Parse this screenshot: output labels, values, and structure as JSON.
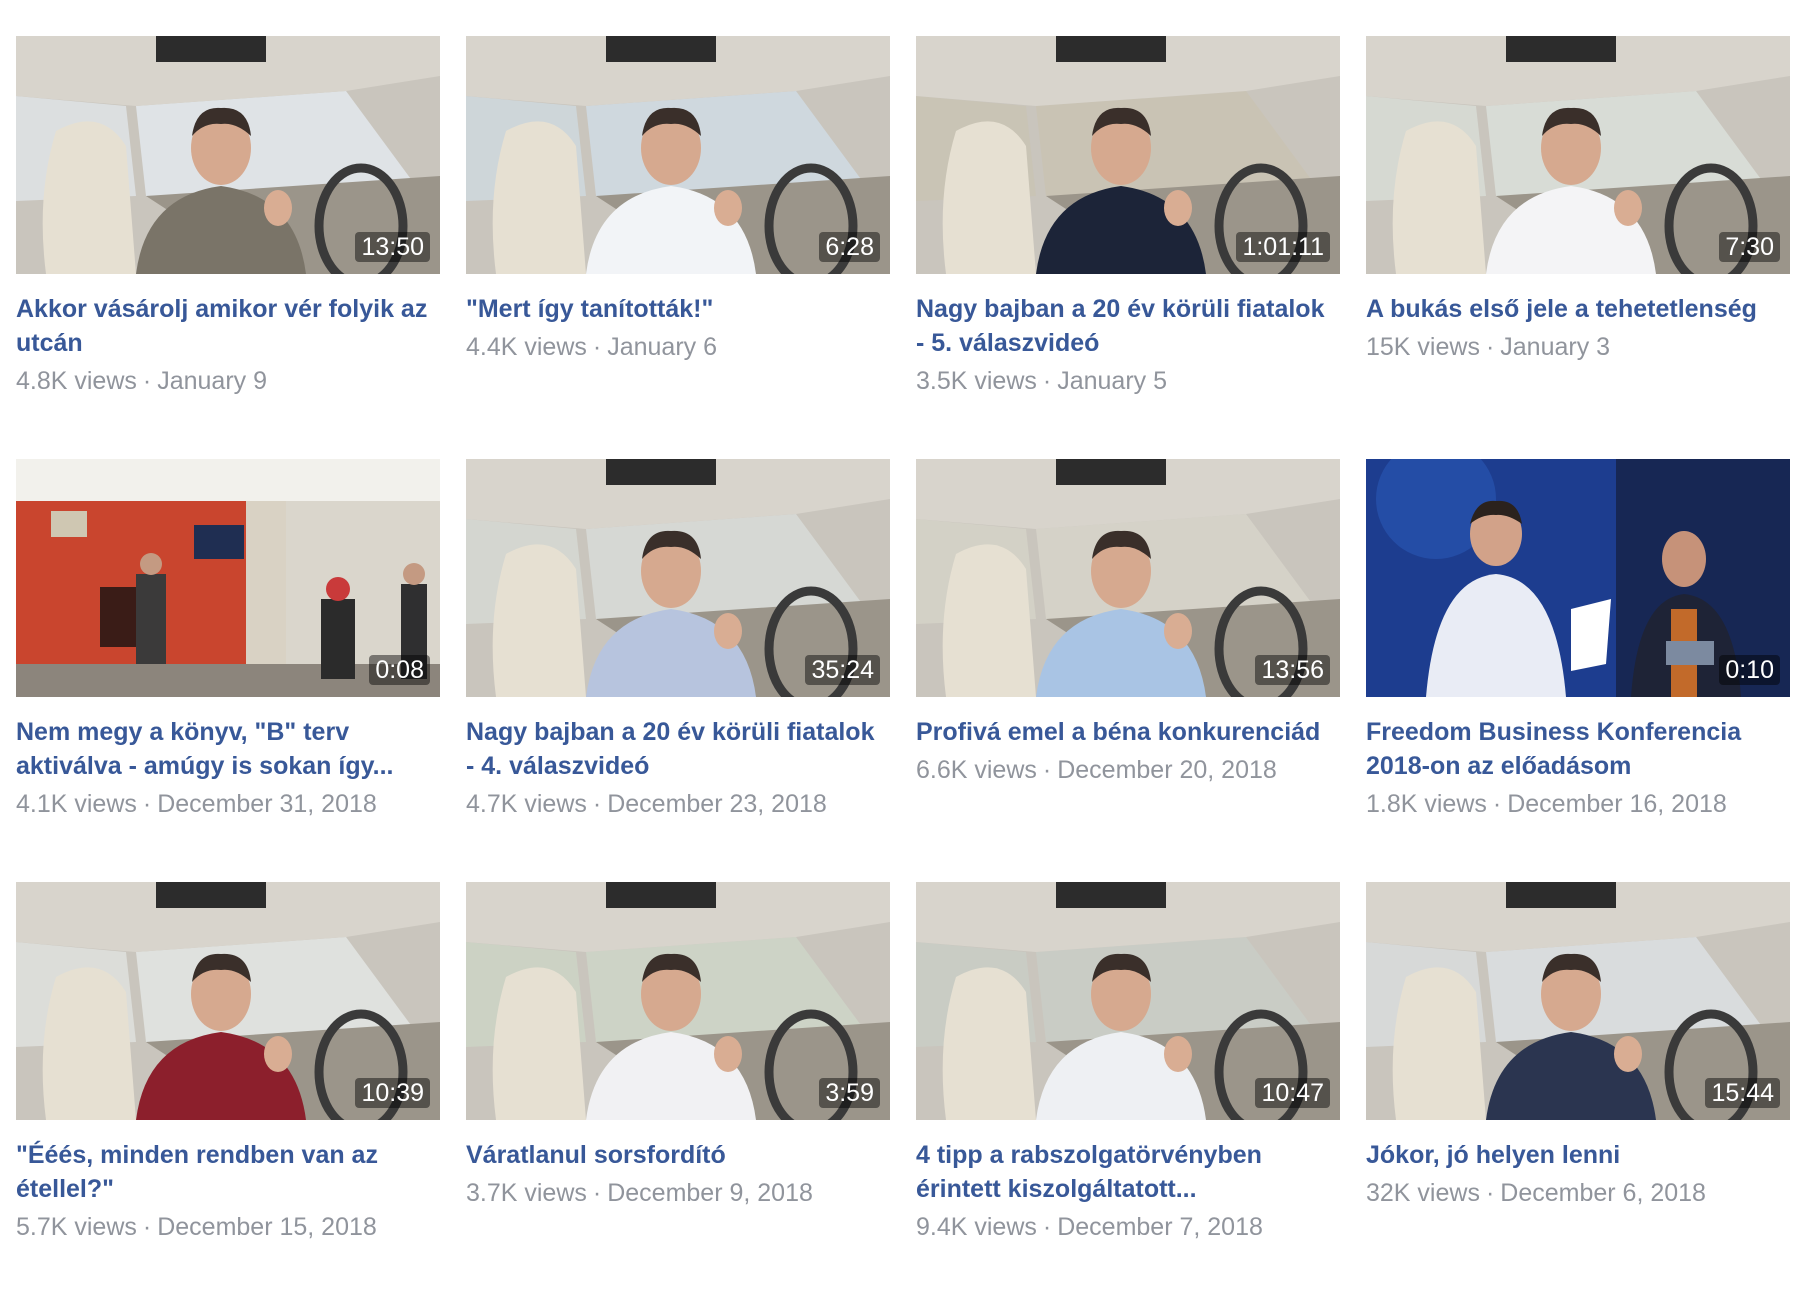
{
  "videos": [
    {
      "title": "Akkor vásárolj amikor vér folyik az utcán",
      "views": "4.8K views",
      "date": "January 9",
      "duration": "13:50",
      "scene": "car",
      "shirt": "#7a7468",
      "sky": "#dfe3e6"
    },
    {
      "title": "\"Mert így tanították!\"",
      "views": "4.4K views",
      "date": "January 6",
      "duration": "6:28",
      "scene": "car",
      "shirt": "#f2f4f7",
      "sky": "#cfd8de"
    },
    {
      "title": "Nagy bajban a 20 év körüli fiatalok - 5. válaszvideó",
      "views": "3.5K views",
      "date": "January 5",
      "duration": "1:01:11",
      "scene": "car",
      "shirt": "#1c2438",
      "sky": "#c9c3b4"
    },
    {
      "title": "A bukás első jele a tehetetlenség",
      "views": "15K views",
      "date": "January 3",
      "duration": "7:30",
      "scene": "car",
      "shirt": "#f4f4f6",
      "sky": "#d8dcd6"
    },
    {
      "title": "Nem megy a könyv, \"B\" terv aktiválva - amúgy is sokan így...",
      "views": "4.1K views",
      "date": "December 31, 2018",
      "duration": "0:08",
      "scene": "station",
      "shirt": "#3b3a3a",
      "sky": "#c9452e"
    },
    {
      "title": "Nagy bajban a 20 év körüli fiatalok - 4. válaszvideó",
      "views": "4.7K views",
      "date": "December 23, 2018",
      "duration": "35:24",
      "scene": "car",
      "shirt": "#b7c4de",
      "sky": "#d6d8d4"
    },
    {
      "title": "Profivá emel a béna konkurenciád",
      "views": "6.6K views",
      "date": "December 20, 2018",
      "duration": "13:56",
      "scene": "car",
      "shirt": "#a9c4e4",
      "sky": "#d5d2c8"
    },
    {
      "title": "Freedom Business Konferencia 2018-on az előadásom",
      "views": "1.8K views",
      "date": "December 16, 2018",
      "duration": "0:10",
      "scene": "stage",
      "shirt": "#e9ecf5",
      "sky": "#1d3d8f"
    },
    {
      "title": "\"Ééés, minden rendben van az étellel?\"",
      "views": "5.7K views",
      "date": "December 15, 2018",
      "duration": "10:39",
      "scene": "car",
      "shirt": "#8c1f2c",
      "sky": "#dfe1de"
    },
    {
      "title": "Váratlanul sorsfordító",
      "views": "3.7K views",
      "date": "December 9, 2018",
      "duration": "3:59",
      "scene": "car",
      "shirt": "#f1f1f3",
      "sky": "#cdd3c6"
    },
    {
      "title": "4 tipp a rabszolgatörvényben érintett kiszolgáltatott...",
      "views": "9.4K views",
      "date": "December 7, 2018",
      "duration": "10:47",
      "scene": "car",
      "shirt": "#eef0f3",
      "sky": "#c9ccc5"
    },
    {
      "title": "Jókor, jó helyen lenni",
      "views": "32K views",
      "date": "December 6, 2018",
      "duration": "15:44",
      "scene": "car",
      "shirt": "#2b3550",
      "sky": "#d9dcdd"
    }
  ],
  "separator": "·"
}
